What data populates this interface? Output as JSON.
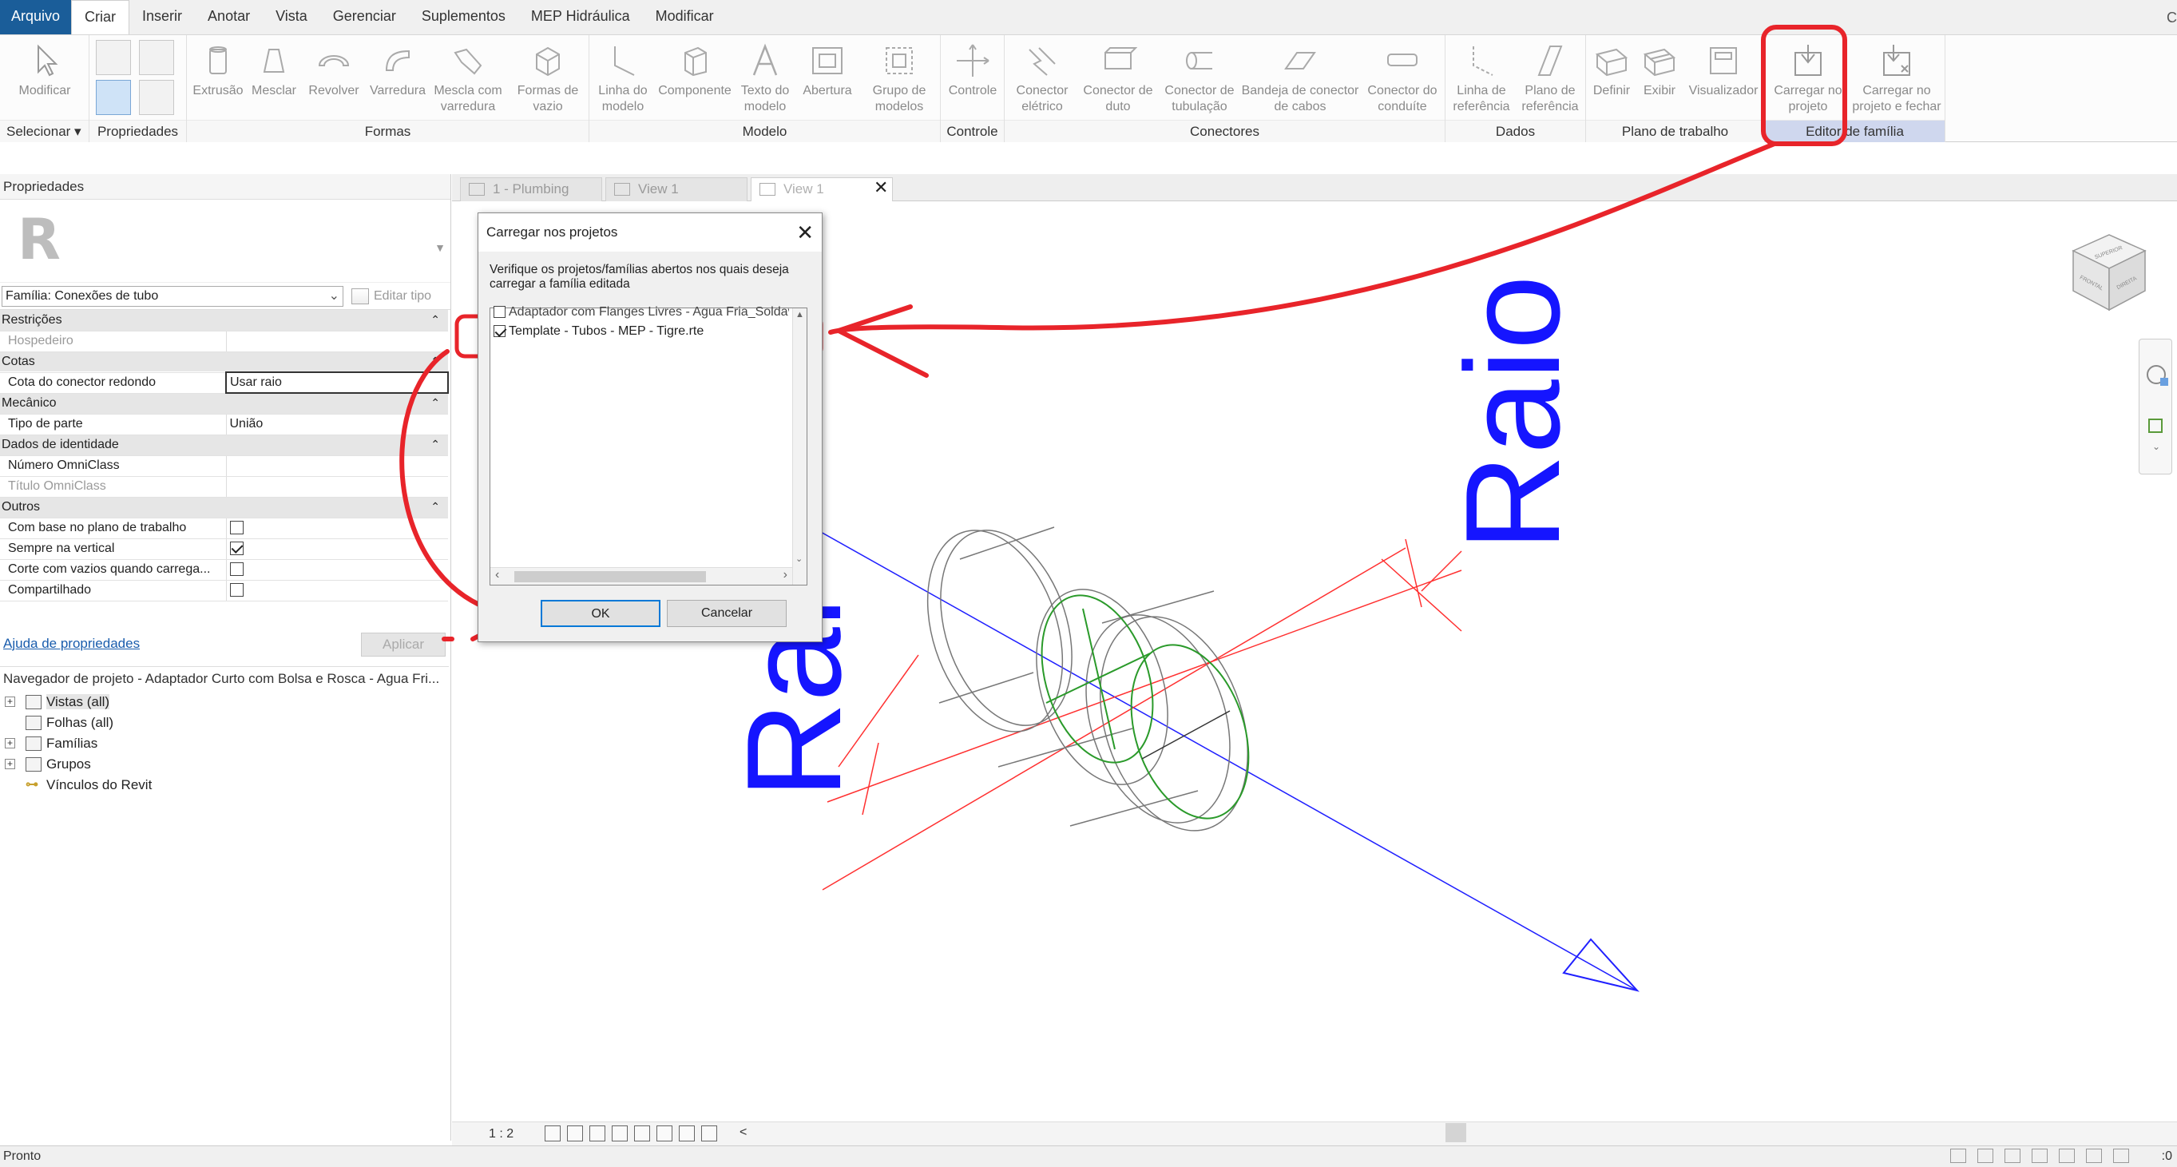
{
  "menu": {
    "file": "Arquivo",
    "tabs": [
      "Criar",
      "Inserir",
      "Anotar",
      "Vista",
      "Gerenciar",
      "Suplementos",
      "MEP Hidráulica",
      "Modificar"
    ],
    "end_glyph": "C"
  },
  "ribbon": {
    "groups": {
      "selecionar": {
        "label": "Selecionar ▾",
        "modify": "Modificar"
      },
      "propriedades": {
        "label": "Propriedades"
      },
      "formas": {
        "label": "Formas",
        "buttons": [
          "Extrusão",
          "Mesclar",
          "Revolver",
          "Varredura",
          "Mescla com\nvarredura",
          "Formas de\nvazio"
        ]
      },
      "modelo": {
        "label": "Modelo",
        "buttons": [
          "Linha do\nmodelo",
          "Componente",
          "Texto do\nmodelo",
          "Abertura",
          "Grupo de\nmodelos"
        ]
      },
      "controle": {
        "label": "Controle",
        "buttons": [
          "Controle"
        ]
      },
      "conectores": {
        "label": "Conectores",
        "buttons": [
          "Conector\nelétrico",
          "Conector de\nduto",
          "Conector de\ntubulação",
          "Bandeja de conector\nde cabos",
          "Conector do\nconduíte"
        ]
      },
      "dados": {
        "label": "Dados",
        "buttons": [
          "Linha de\nreferência",
          "Plano de\nreferência"
        ]
      },
      "plano": {
        "label": "Plano de trabalho",
        "buttons": [
          "Definir",
          "Exibir",
          "Visualizador"
        ]
      },
      "editor": {
        "label": "Editor de família",
        "buttons": [
          "Carregar no\nprojeto",
          "Carregar no\nprojeto e fechar"
        ]
      }
    }
  },
  "properties": {
    "title": "Propriedades",
    "family": "Família: Conexões de tubo",
    "edit_type": "Editar tipo",
    "sections": {
      "restricoes": "Restrições",
      "cotas": "Cotas",
      "mecanico": "Mecânico",
      "identidade": "Dados de identidade",
      "outros": "Outros"
    },
    "rows": {
      "hospedeiro": {
        "k": "Hospedeiro",
        "v": ""
      },
      "cota_conector": {
        "k": "Cota do conector redondo",
        "v": "Usar raio"
      },
      "tipo_parte": {
        "k": "Tipo de parte",
        "v": "União"
      },
      "numero_omni": {
        "k": "Número OmniClass",
        "v": ""
      },
      "titulo_omni": {
        "k": "Título OmniClass",
        "v": ""
      },
      "com_base": {
        "k": "Com base no plano de trabalho",
        "checked": false
      },
      "sempre_vertical": {
        "k": "Sempre na vertical",
        "checked": true
      },
      "corte_vazios": {
        "k": "Corte com vazios quando carrega...",
        "checked": false
      },
      "compartilhado": {
        "k": "Compartilhado",
        "checked": false
      }
    },
    "help_link": "Ajuda de propriedades",
    "apply": "Aplicar"
  },
  "navigator": {
    "title": "Navegador de projeto - Adaptador Curto com Bolsa e Rosca - Agua Fri...",
    "items": [
      "Vistas (all)",
      "Folhas (all)",
      "Famílias",
      "Grupos",
      "Vínculos do Revit"
    ]
  },
  "view_tabs": [
    "1 - Plumbing",
    "View 1",
    "View 1"
  ],
  "view_bar": {
    "scale": "1 : 2",
    "arrow": "<"
  },
  "status": {
    "text": "Pronto",
    "zero": ":0"
  },
  "viewcube": {
    "top": "SUPERIOR",
    "front": "FRONTAL",
    "right": "DIREITA"
  },
  "dialog": {
    "title": "Carregar nos projetos",
    "message": "Verifique os projetos/famílias abertos nos quais deseja carregar a família editada",
    "items": [
      {
        "label": "Adaptador com Flanges Livres - Agua Fria_Soldav",
        "checked": false
      },
      {
        "label": "Template - Tubos - MEP - Tigre.rte",
        "checked": true
      }
    ],
    "ok": "OK",
    "cancel": "Cancelar"
  },
  "canvas_labels": {
    "raio_vertical": "Raio",
    "raio_partial": "Rai"
  },
  "colors": {
    "annotation": "#e8242a",
    "dimension": "#1515ff",
    "ribbon_highlight": "#cfd7ee",
    "link": "#1a5dad"
  }
}
